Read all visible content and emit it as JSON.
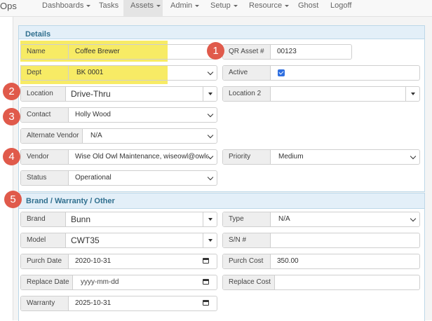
{
  "nav": {
    "brand": "Ops",
    "items": [
      {
        "label": "Dashboards",
        "dropdown": true
      },
      {
        "label": "Tasks",
        "dropdown": false
      },
      {
        "label": "Assets",
        "dropdown": true,
        "active": true
      },
      {
        "label": "Admin",
        "dropdown": true
      },
      {
        "label": "Setup",
        "dropdown": true
      },
      {
        "label": "Resource",
        "dropdown": true
      },
      {
        "label": "Ghost",
        "dropdown": false
      },
      {
        "label": "Logoff",
        "dropdown": false
      }
    ]
  },
  "details": {
    "heading": "Details",
    "name": {
      "label": "Name",
      "value": "Coffee Brewer"
    },
    "qr_asset": {
      "label": "QR Asset #",
      "value": "00123"
    },
    "dept": {
      "label": "Dept",
      "value": "BK 0001"
    },
    "active": {
      "label": "Active",
      "checked": true
    },
    "location": {
      "label": "Location",
      "value": "Drive-Thru"
    },
    "location2": {
      "label": "Location 2",
      "value": ""
    },
    "contact": {
      "label": "Contact",
      "value": "Holly Wood"
    },
    "alt_vendor": {
      "label": "Alternate Vendor",
      "value": "N/A"
    },
    "vendor": {
      "label": "Vendor",
      "value": "Wise Old Owl Maintenance, wiseowl@owlop"
    },
    "priority": {
      "label": "Priority",
      "value": "Medium"
    },
    "status": {
      "label": "Status",
      "value": "Operational"
    }
  },
  "brand_section": {
    "heading": "Brand / Warranty / Other",
    "brand": {
      "label": "Brand",
      "value": "Bunn"
    },
    "type": {
      "label": "Type",
      "value": "N/A"
    },
    "model": {
      "label": "Model",
      "value": "CWT35"
    },
    "serial": {
      "label": "S/N #",
      "value": ""
    },
    "purch_date": {
      "label": "Purch Date",
      "value": "2020-10-31"
    },
    "purch_cost": {
      "label": "Purch Cost",
      "value": "350.00"
    },
    "replace_date": {
      "label": "Replace Date",
      "placeholder": "yyyy-mm-dd"
    },
    "replace_cost": {
      "label": "Replace Cost",
      "value": ""
    },
    "warranty": {
      "label": "Warranty",
      "value": "2025-10-31"
    }
  },
  "callouts": [
    "1",
    "2",
    "3",
    "4",
    "5"
  ],
  "colors": {
    "highlight": "#f6e84a",
    "callout": "#e05a4b",
    "panel_heading": "#31708f",
    "check": "#2f6fe0"
  }
}
